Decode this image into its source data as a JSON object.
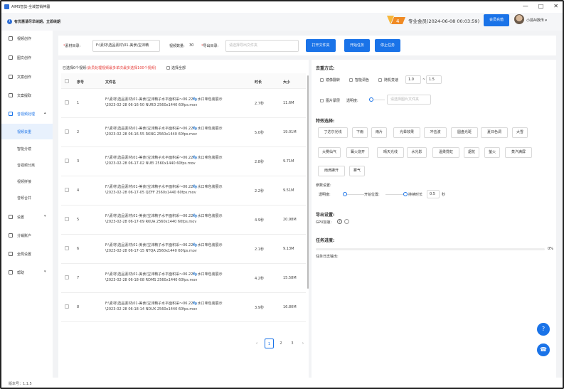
{
  "window": {
    "title": "AIMS智剪-全域营销神器",
    "min": "—",
    "max": "□",
    "close": "✕"
  },
  "notice": {
    "text": "有优惠请尽早续期，立即续期"
  },
  "account": {
    "vip_label": "专业会员(2024-06-08 00:03:59)",
    "renew_button": "会员充值",
    "username": "小狐AI数传"
  },
  "sidebar": {
    "items": [
      {
        "label": "视频创作"
      },
      {
        "label": "图文创作"
      },
      {
        "label": "文案创作"
      },
      {
        "label": "文案提取"
      },
      {
        "label": "音视频处理",
        "expanded": true
      },
      {
        "label": "设置"
      },
      {
        "label": "分销账户"
      },
      {
        "label": "全局设置"
      },
      {
        "label": "帮助"
      }
    ],
    "sub_items": [
      {
        "label": "视频去重",
        "selected": true
      },
      {
        "label": "智能分镜"
      },
      {
        "label": "音视频分离"
      },
      {
        "label": "视频拼接"
      },
      {
        "label": "音频合并"
      }
    ],
    "version": "版本号：1.1.5"
  },
  "toolbar": {
    "material_dir_label": "素材目录:",
    "material_dir_value": "F:\\素材\\选品素材\\01-美食\\宝沫精",
    "video_count_label": "视频数量:",
    "video_count_value": "30",
    "export_dir_label": "导出目录:",
    "export_dir_placeholder": "请选择导出文件夹",
    "open_folder": "打开文件夹",
    "start_task": "开始任务",
    "stop_task": "停止任务"
  },
  "table": {
    "selected_info": "已选择0个视频",
    "limit_note": "(会员处理视频最多单次最多选择100个视频)",
    "select_all": "选择全部",
    "headers": {
      "index": "序号",
      "filename": "文件名",
      "duration": "时长",
      "size": "大小"
    },
    "rows": [
      {
        "index": "1",
        "name_a": "F:\\素材\\选品素材\\01-美食\\宝沫精子水平面积采～06.22",
        "emoji": "👣",
        "name_b": "水口味包装展示",
        "name_c": "\\2023-02-28 06-16-50 NURD 2560x1440 60fps.mov",
        "duration": "2.7秒",
        "size": "11.6M"
      },
      {
        "index": "2",
        "name_a": "F:\\素材\\选品素材\\01-美食\\宝沫精子水平面积采～06.22",
        "emoji": "👣",
        "name_b": "水口味包装展示",
        "name_c": "\\2023-02-28 06-16-55 RKNG 2560x1440 60fps.mov",
        "duration": "5.0秒",
        "size": "19.01M"
      },
      {
        "index": "3",
        "name_a": "F:\\素材\\选品素材\\01-美食\\宝沫精子水平面积采～06.22",
        "emoji": "👣",
        "name_b": "水口味包装展示",
        "name_c": "\\2023-02-28 06-17-02 NUEI 2560x1440 60fps.mov",
        "duration": "2.8秒",
        "size": "9.71M"
      },
      {
        "index": "4",
        "name_a": "F:\\素材\\选品素材\\01-美食\\宝沫精子水平面积采～06.22",
        "emoji": "👣",
        "name_b": "水口味包装展示",
        "name_c": "\\2023-02-28 06-17-05 QZFF 2560x1440 60fps.mov",
        "duration": "2.2秒",
        "size": "9.51M"
      },
      {
        "index": "5",
        "name_a": "F:\\素材\\选品素材\\01-美食\\宝沫精子水平面积采～06.22",
        "emoji": "👣",
        "name_b": "水口味包装展示",
        "name_c": "\\2023-02-28 06-17-09 RKUA 2560x1440 60fps.mov",
        "duration": "4.9秒",
        "size": "20.98M"
      },
      {
        "index": "6",
        "name_a": "F:\\素材\\选品素材\\01-美食\\宝沫精子水平面积采～06.22",
        "emoji": "👣",
        "name_b": "水口味包装展示",
        "name_c": "\\2023-02-28 06-17-15 NTQA 2560x1440 60fps.mov",
        "duration": "2.1秒",
        "size": "9.13M"
      },
      {
        "index": "7",
        "name_a": "F:\\素材\\选品素材\\01-美食\\宝沫精子水平面积采～06.22",
        "emoji": "👣",
        "name_b": "水口味包装展示",
        "name_c": "\\2023-02-28 06-18-08 RDMS 2560x1440 60fps.mov",
        "duration": "4.2秒",
        "size": "15.58M"
      },
      {
        "index": "8",
        "name_a": "F:\\素材\\选品素材\\01-美食\\宝沫精子水平面积采～06.22",
        "emoji": "👣",
        "name_b": "水口味包装展示",
        "name_c": "\\2023-02-28 06-18-14 NDUX 2560x1440 60fps.mov",
        "duration": "3.9秒",
        "size": "16.80M"
      }
    ]
  },
  "pager": {
    "prev": "‹",
    "pages": [
      "1",
      "2",
      "3"
    ],
    "next": "›"
  },
  "settings": {
    "dedup_title": "去重方式:",
    "mirror": "镜像翻转",
    "smart_color": "智能调色",
    "random_speed": "随机变速",
    "speed_min": "1.0",
    "speed_sep": "~",
    "speed_max": "1.5",
    "image_mask": "图片蒙层",
    "opacity_label": "透明度:",
    "mask_placeholder": "请选择图片文件夹",
    "effects_title": "特效选择:",
    "effects": [
      "丁达尔光线",
      "下雨",
      "雨片",
      "光晕效果",
      "冲击波",
      "圆盘光斑",
      "夏日色调",
      "大雪",
      "大雾仙气",
      "篝火烧开",
      "晴天光线",
      "水光影",
      "温柔霓虹",
      "烟花",
      "萤火",
      "蒸汽满屏",
      "雨滴拂开",
      "雾气"
    ],
    "param_title": "参数设置:",
    "param_opacity": "透明度:",
    "param_start": "开始位置:",
    "param_duration": "持续时长",
    "param_duration_value": "0.5",
    "param_duration_unit": "秒",
    "export_title": "导出设置:",
    "gpu_label": "GPU加速:",
    "progress_title": "任务进度:",
    "progress_value": "0%",
    "progress_fraction": 0,
    "log_label": "任务日志输出:"
  },
  "float": {
    "help": "?",
    "service": "☎"
  }
}
